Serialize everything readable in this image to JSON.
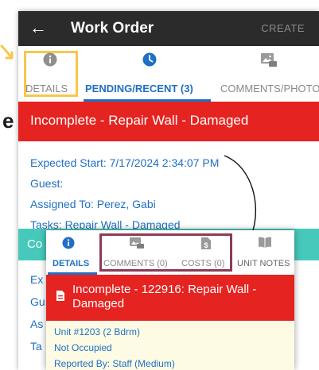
{
  "header": {
    "title": "Work Order",
    "action": "CREATE"
  },
  "tabs": {
    "details": "DETAILS",
    "pending": "PENDING/RECENT (3)",
    "comments": "COMMENTS/PHOTOS"
  },
  "main_banner": "Incomplete - Repair Wall - Damaged",
  "details": {
    "expected_start": "Expected Start: 7/17/2024 2:34:07 PM",
    "guest": "Guest:",
    "assigned_to": "Assigned To: Perez, Gabi",
    "tasks": "Tasks: Repair Wall - Damaged"
  },
  "second_banner": "Co",
  "back_lines": [
    "Ex",
    "Gu",
    "As",
    "Ta"
  ],
  "edge_letter": "e",
  "overlay": {
    "tabs": {
      "details": "DETAILS",
      "comments": "COMMENTS (0)",
      "costs": "COSTS (0)",
      "notes": "UNIT NOTES"
    },
    "banner": "Incomplete - 122916: Repair Wall - Damaged",
    "unit": "Unit #1203 (2 Bdrm)",
    "occupancy": "Not Occupied",
    "reported_by": "Reported By: Staff (Medium)"
  },
  "colors": {
    "app_bar": "#2b2b2b",
    "accent_blue": "#1f6fc5",
    "banner_red": "#e52320",
    "banner_teal": "#46c9ba",
    "highlight_yellow": "#f7c64d",
    "highlight_maroon": "#8e3b55",
    "info_bg": "#fdfbe4"
  }
}
